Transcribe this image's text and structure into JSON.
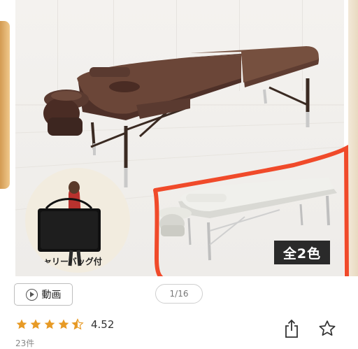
{
  "gallery": {
    "color_badge": "全2色",
    "inset_caption": "キャリーバッグ付",
    "page_indicator": "1/16",
    "video_label": "動画",
    "highlight_color": "#f04a2a",
    "main_table_color": "#5a3a30",
    "alt_table_color": "#eeeeea"
  },
  "product": {
    "rating_value": "4.52",
    "rating": 4.52,
    "review_count": "23件",
    "star_color": "#e79a25",
    "stars": [
      "full",
      "full",
      "full",
      "full",
      "half"
    ]
  },
  "icons": {
    "play": "play-icon",
    "share": "share-icon",
    "favorite": "star-outline-icon"
  }
}
